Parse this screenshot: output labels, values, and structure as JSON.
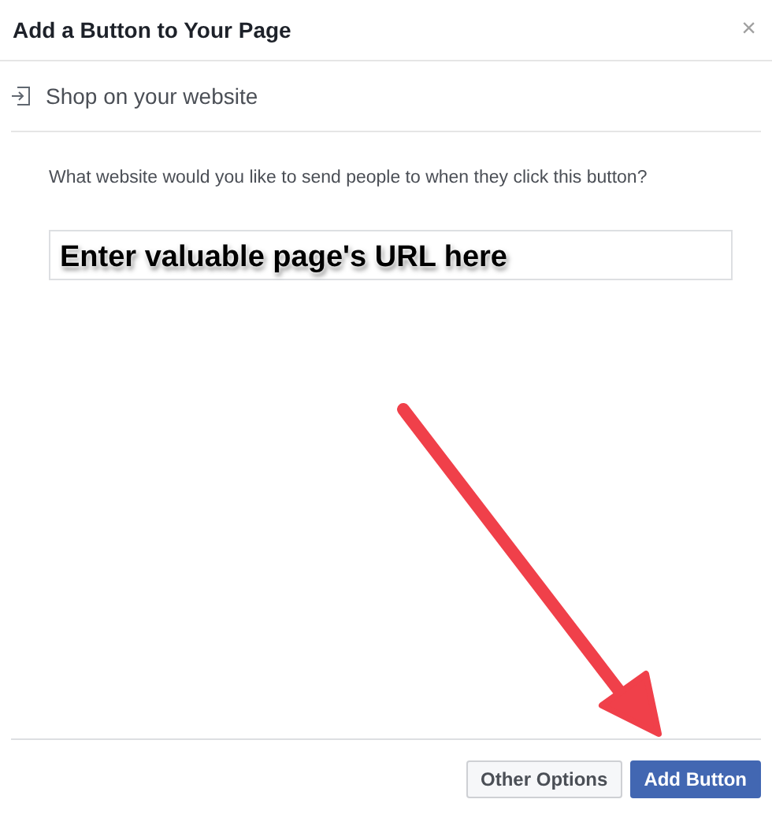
{
  "dialog": {
    "title": "Add a Button to Your Page",
    "close": "×"
  },
  "option": {
    "label": "Shop on your website"
  },
  "question": "What website would you like to send people to when they click this button?",
  "annotation": {
    "text": "Enter valuable page's URL here"
  },
  "buttons": [
    {
      "label": "Other Options",
      "kind": "secondary"
    },
    {
      "label": "Add Button",
      "kind": "primary"
    }
  ]
}
